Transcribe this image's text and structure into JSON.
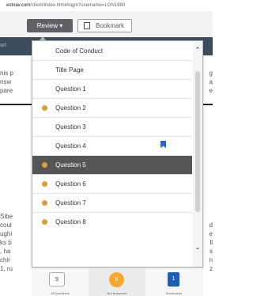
{
  "browser": {
    "url_domain": "estnav.com",
    "url_path": "/client/index.html#login?username=LON1880"
  },
  "toolbar": {
    "review_label": "Review ▾",
    "bookmark_label": "Bookmark"
  },
  "background": {
    "nav_left": "art",
    "lines_top": [
      {
        "left": "nis p",
        "right": "g"
      },
      {
        "left": "nsw",
        "right": "a"
      },
      {
        "left": "pare",
        "right": "e"
      }
    ],
    "lines_bottom": [
      {
        "left": "Sibe",
        "right": ""
      },
      {
        "left": "coul",
        "right": "d"
      },
      {
        "left": "ughi",
        "right": "e"
      },
      {
        "left": "ks b",
        "right": "ll"
      },
      {
        "left": ", ha",
        "right": "s"
      },
      {
        "left": "chir",
        "right": "n"
      },
      {
        "left": "1, ru",
        "right": "z"
      }
    ]
  },
  "review_menu": {
    "items": [
      {
        "label": "Code of Conduct",
        "answered": false,
        "flagged": false,
        "current": false
      },
      {
        "label": "Title Page",
        "answered": false,
        "flagged": false,
        "current": false
      },
      {
        "label": "Question 1",
        "answered": false,
        "flagged": false,
        "current": false
      },
      {
        "label": "Question 2",
        "answered": true,
        "flagged": false,
        "current": false
      },
      {
        "label": "Question 3",
        "answered": false,
        "flagged": false,
        "current": false
      },
      {
        "label": "Question 4",
        "answered": false,
        "flagged": true,
        "current": false
      },
      {
        "label": "Question 5",
        "answered": true,
        "flagged": false,
        "current": true
      },
      {
        "label": "Question 6",
        "answered": true,
        "flagged": false,
        "current": false
      },
      {
        "label": "Question 7",
        "answered": true,
        "flagged": false,
        "current": false
      },
      {
        "label": "Question 8",
        "answered": true,
        "flagged": false,
        "current": false
      }
    ],
    "scroll_up_glyph": "⌃",
    "scroll_down_glyph": "⌄"
  },
  "summary": {
    "all_count": "9",
    "all_label": "All Questions",
    "unanswered_count": "6",
    "unanswered_label": "Not Answered",
    "bookmarks_count": "1",
    "bookmarks_label": "Bookmarks"
  },
  "colors": {
    "answered_dot": "#e59a38",
    "flag": "#1a6bd6",
    "active_row": "#555555"
  }
}
